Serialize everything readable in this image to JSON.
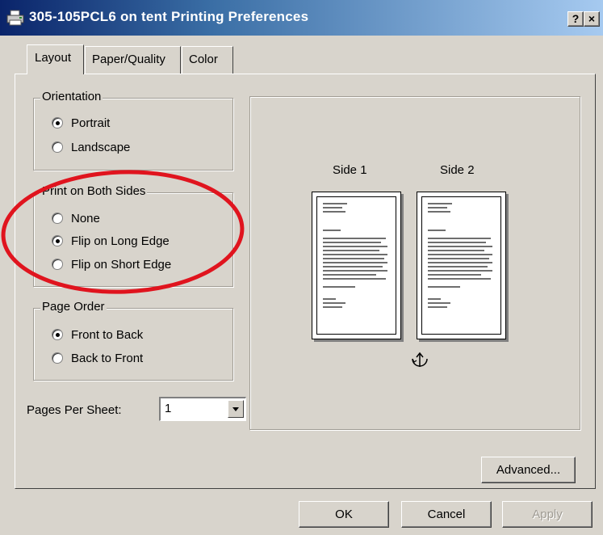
{
  "window": {
    "title": "305-105PCL6 on tent Printing Preferences",
    "help_label": "?",
    "close_label": "×"
  },
  "tabs": [
    {
      "label": "Layout",
      "active": true
    },
    {
      "label": "Paper/Quality",
      "active": false
    },
    {
      "label": "Color",
      "active": false
    }
  ],
  "orientation": {
    "title": "Orientation",
    "options": [
      {
        "label": "Portrait",
        "checked": true
      },
      {
        "label": "Landscape",
        "checked": false
      }
    ]
  },
  "print_both_sides": {
    "title": "Print on Both Sides",
    "options": [
      {
        "label": "None",
        "checked": false
      },
      {
        "label": "Flip on Long Edge",
        "checked": true
      },
      {
        "label": "Flip on Short Edge",
        "checked": false
      }
    ]
  },
  "page_order": {
    "title": "Page Order",
    "options": [
      {
        "label": "Front to Back",
        "checked": true
      },
      {
        "label": "Back to Front",
        "checked": false
      }
    ]
  },
  "pages_per_sheet": {
    "label": "Pages Per Sheet:",
    "value": "1"
  },
  "preview": {
    "side1_label": "Side 1",
    "side2_label": "Side 2"
  },
  "buttons": {
    "advanced": "Advanced...",
    "ok": "OK",
    "cancel": "Cancel",
    "apply": "Apply"
  },
  "colors": {
    "annotation": "#e0141e",
    "title_bar_start": "#0a246a",
    "title_bar_end": "#a6caf0"
  },
  "icons": {
    "window": "printer-icon",
    "preview_rotate": "rotate-arrow-icon"
  }
}
